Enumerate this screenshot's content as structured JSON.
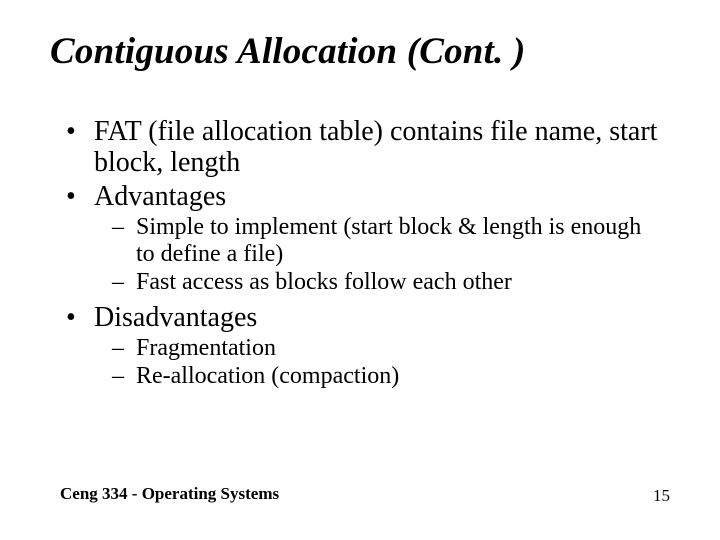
{
  "title": "Contiguous Allocation (Cont. )",
  "bullets": {
    "b1": "FAT (file allocation table) contains file name, start block, length",
    "b2": "Advantages",
    "b2_1": "Simple to implement (start block & length is enough to define a file)",
    "b2_2": "Fast access as blocks follow each other",
    "b3": "Disadvantages",
    "b3_1": "Fragmentation",
    "b3_2": "Re-allocation (compaction)"
  },
  "footer": {
    "course": "Ceng 334 - Operating Systems",
    "page": "15"
  }
}
